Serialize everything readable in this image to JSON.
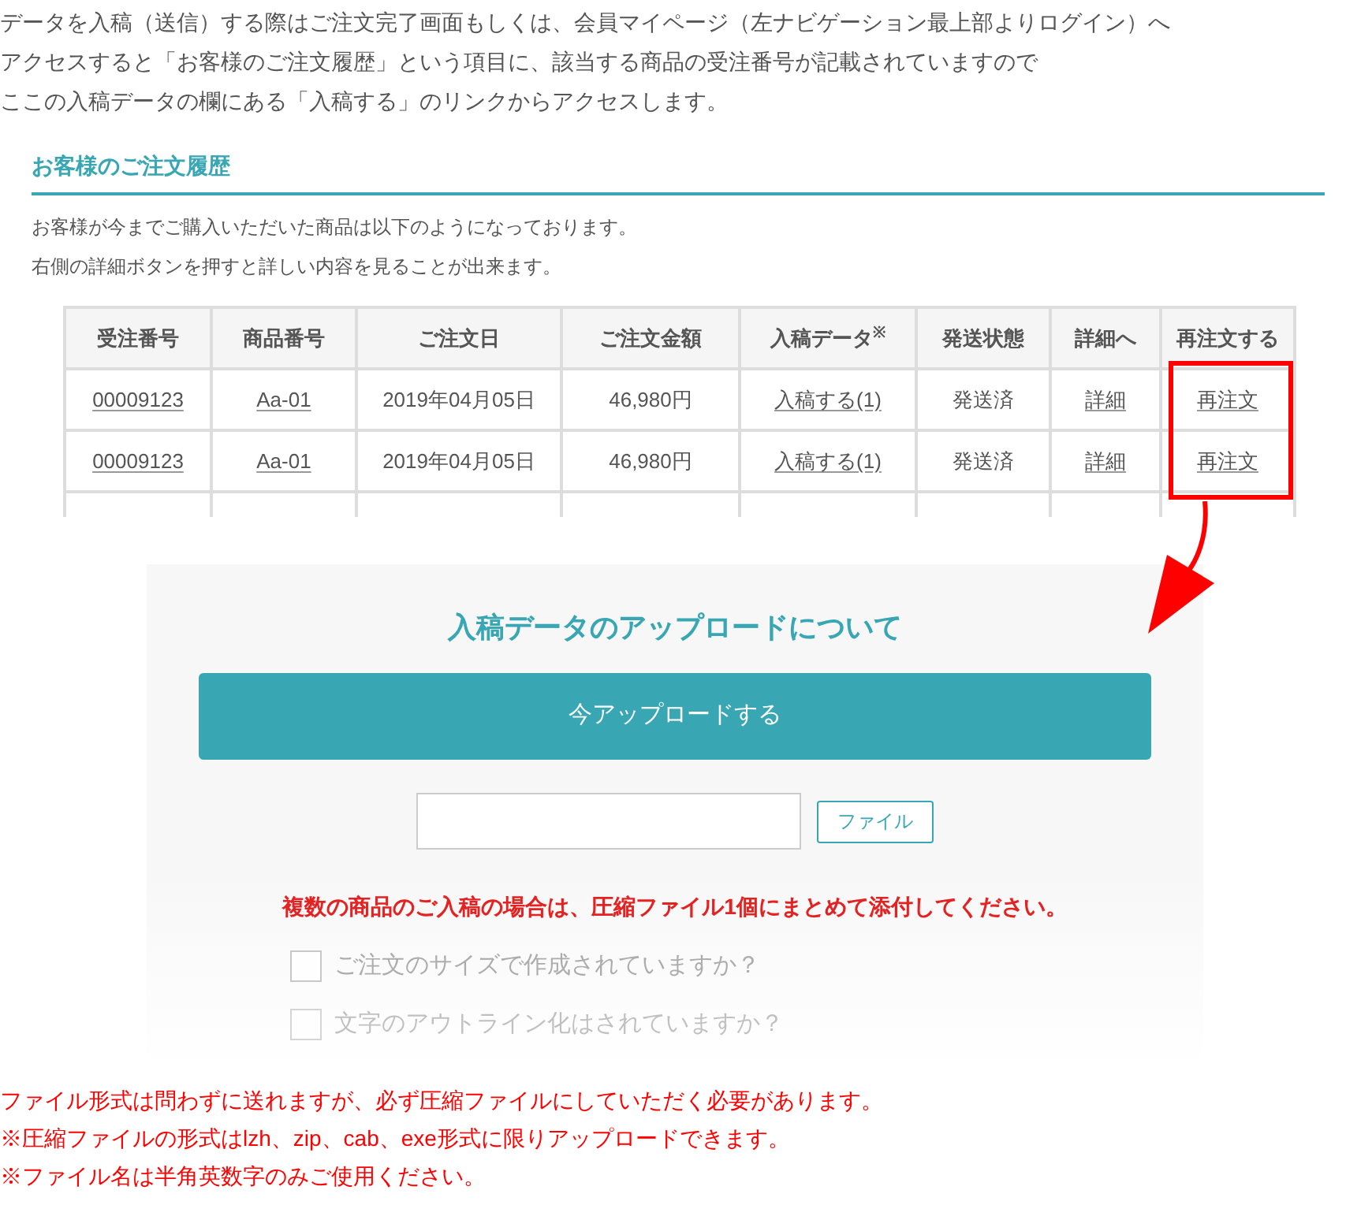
{
  "intro": [
    "データを入稿（送信）する際はご注文完了画面もしくは、会員マイページ（左ナビゲーション最上部よりログイン）へ",
    "アクセスすると「お客様のご注文履歴」という項目に、該当する商品の受注番号が記載されていますので",
    "ここの入稿データの欄にある「入稿する」のリンクからアクセスします。"
  ],
  "history": {
    "title": "お客様のご注文履歴",
    "description": [
      "お客様が今までご購入いただいた商品は以下のようになっております。",
      "右側の詳細ボタンを押すと詳しい内容を見ることが出来ます。"
    ],
    "table": {
      "columns": [
        "受注番号",
        "商品番号",
        "ご注文日",
        "ご注文金額",
        "入稿データ$^{※}$",
        "発送状態",
        "詳細へ",
        "再注文する"
      ],
      "rows": [
        [
          "00009123",
          "Aa-01",
          "2019年04月05日",
          "46,980円",
          "入稿する(1)",
          "発送済",
          "詳細",
          "再注文"
        ],
        [
          "00009123",
          "Aa-01",
          "2019年04月05日",
          "46,980円",
          "入稿する(1)",
          "発送済",
          "詳細",
          "再注文"
        ]
      ],
      "link_columns": [
        true,
        true,
        false,
        false,
        true,
        false,
        true,
        true
      ]
    }
  },
  "upload": {
    "title": "入稿データのアップロードについて",
    "upload_button": "今アップロードする",
    "file_button": "ファイル",
    "warning": "複数の商品のご入稿の場合は、圧縮ファイル1個にまとめて添付してください。",
    "checks": [
      {
        "label": "ご注文のサイズで作成されていますか？",
        "checked": false
      },
      {
        "label": "文字のアウトライン化はされていますか？",
        "checked": false
      }
    ]
  },
  "notes": [
    "ファイル形式は問わずに送れますが、必ず圧縮ファイルにしていただく必要があります。",
    "※圧縮ファイルの形式はlzh、zip、cab、exe形式に限りアップロードできます。",
    "※ファイル名は半角英数字のみご使用ください。"
  ]
}
